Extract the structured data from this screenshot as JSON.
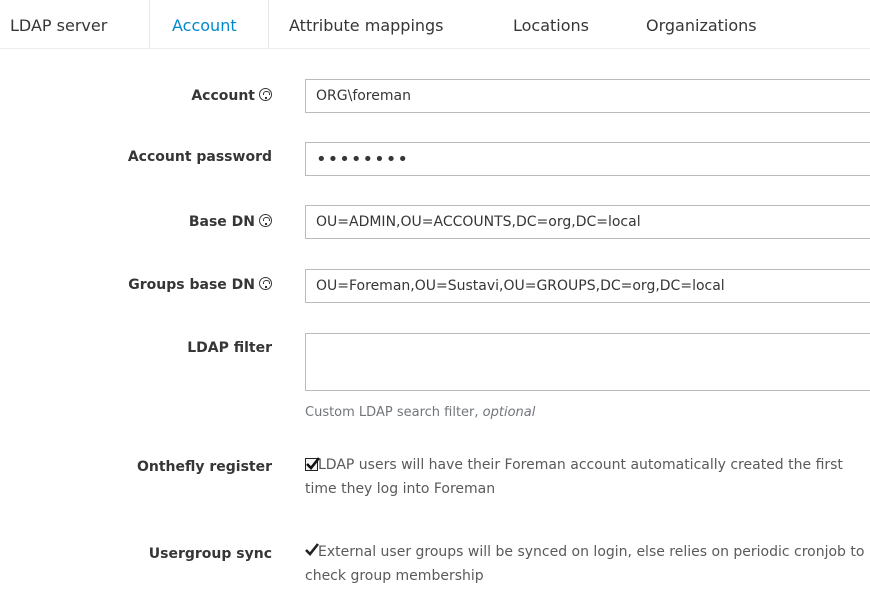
{
  "tabs": [
    "LDAP server",
    "Account",
    "Attribute mappings",
    "Locations",
    "Organizations"
  ],
  "form": {
    "account": {
      "label": "Account",
      "value": "ORG\\foreman"
    },
    "account_password": {
      "label": "Account password",
      "value": "••••••••"
    },
    "base_dn": {
      "label": "Base DN",
      "value": "OU=ADMIN,OU=ACCOUNTS,DC=org,DC=local"
    },
    "groups_base_dn": {
      "label": "Groups base DN",
      "value": "OU=Foreman,OU=Sustavi,OU=GROUPS,DC=org,DC=local"
    },
    "ldap_filter": {
      "label": "LDAP filter",
      "value": "",
      "help_prefix": "Custom LDAP search filter, ",
      "help_optional": "optional"
    },
    "onthefly_register": {
      "label": "Onthefly register",
      "checked": true,
      "text": "LDAP users will have their Foreman account automatically created the first time they log into Foreman"
    },
    "usergroup_sync": {
      "label": "Usergroup sync",
      "checked": true,
      "text": "External user groups will be synced on login, else relies on periodic cronjob to check group membership"
    }
  },
  "colors": {
    "active_tab": "#0088ce",
    "label": "#363636",
    "help": "#72767b",
    "border": "#bbbbbb"
  }
}
